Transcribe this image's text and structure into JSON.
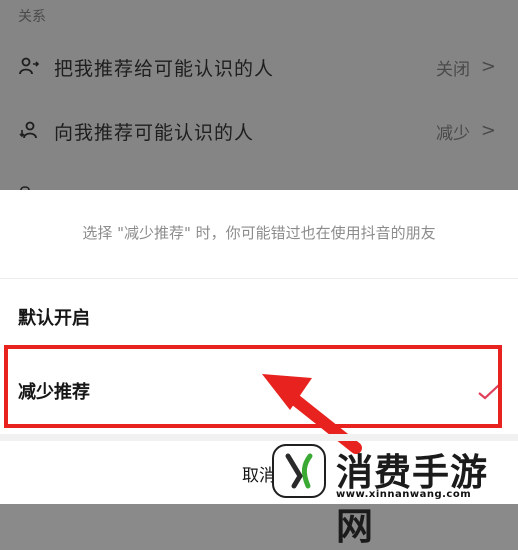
{
  "settings": {
    "section_title": "关系",
    "rows": [
      {
        "label": "把我推荐给可能认识的人",
        "value": "关闭"
      },
      {
        "label": "向我推荐可能认识的人",
        "value": "减少"
      }
    ]
  },
  "sheet": {
    "hint": "选择 \"减少推荐\" 时，你可能错过也在使用抖音的朋友",
    "options": [
      {
        "label": "默认开启"
      },
      {
        "label": "减少推荐",
        "selected": true
      }
    ],
    "cancel_label": "取消"
  },
  "colors": {
    "highlight": "#e8231f",
    "check": "#e0405a"
  },
  "watermark": {
    "title": "消费手游网",
    "url": "www.xinnanwang.com"
  }
}
